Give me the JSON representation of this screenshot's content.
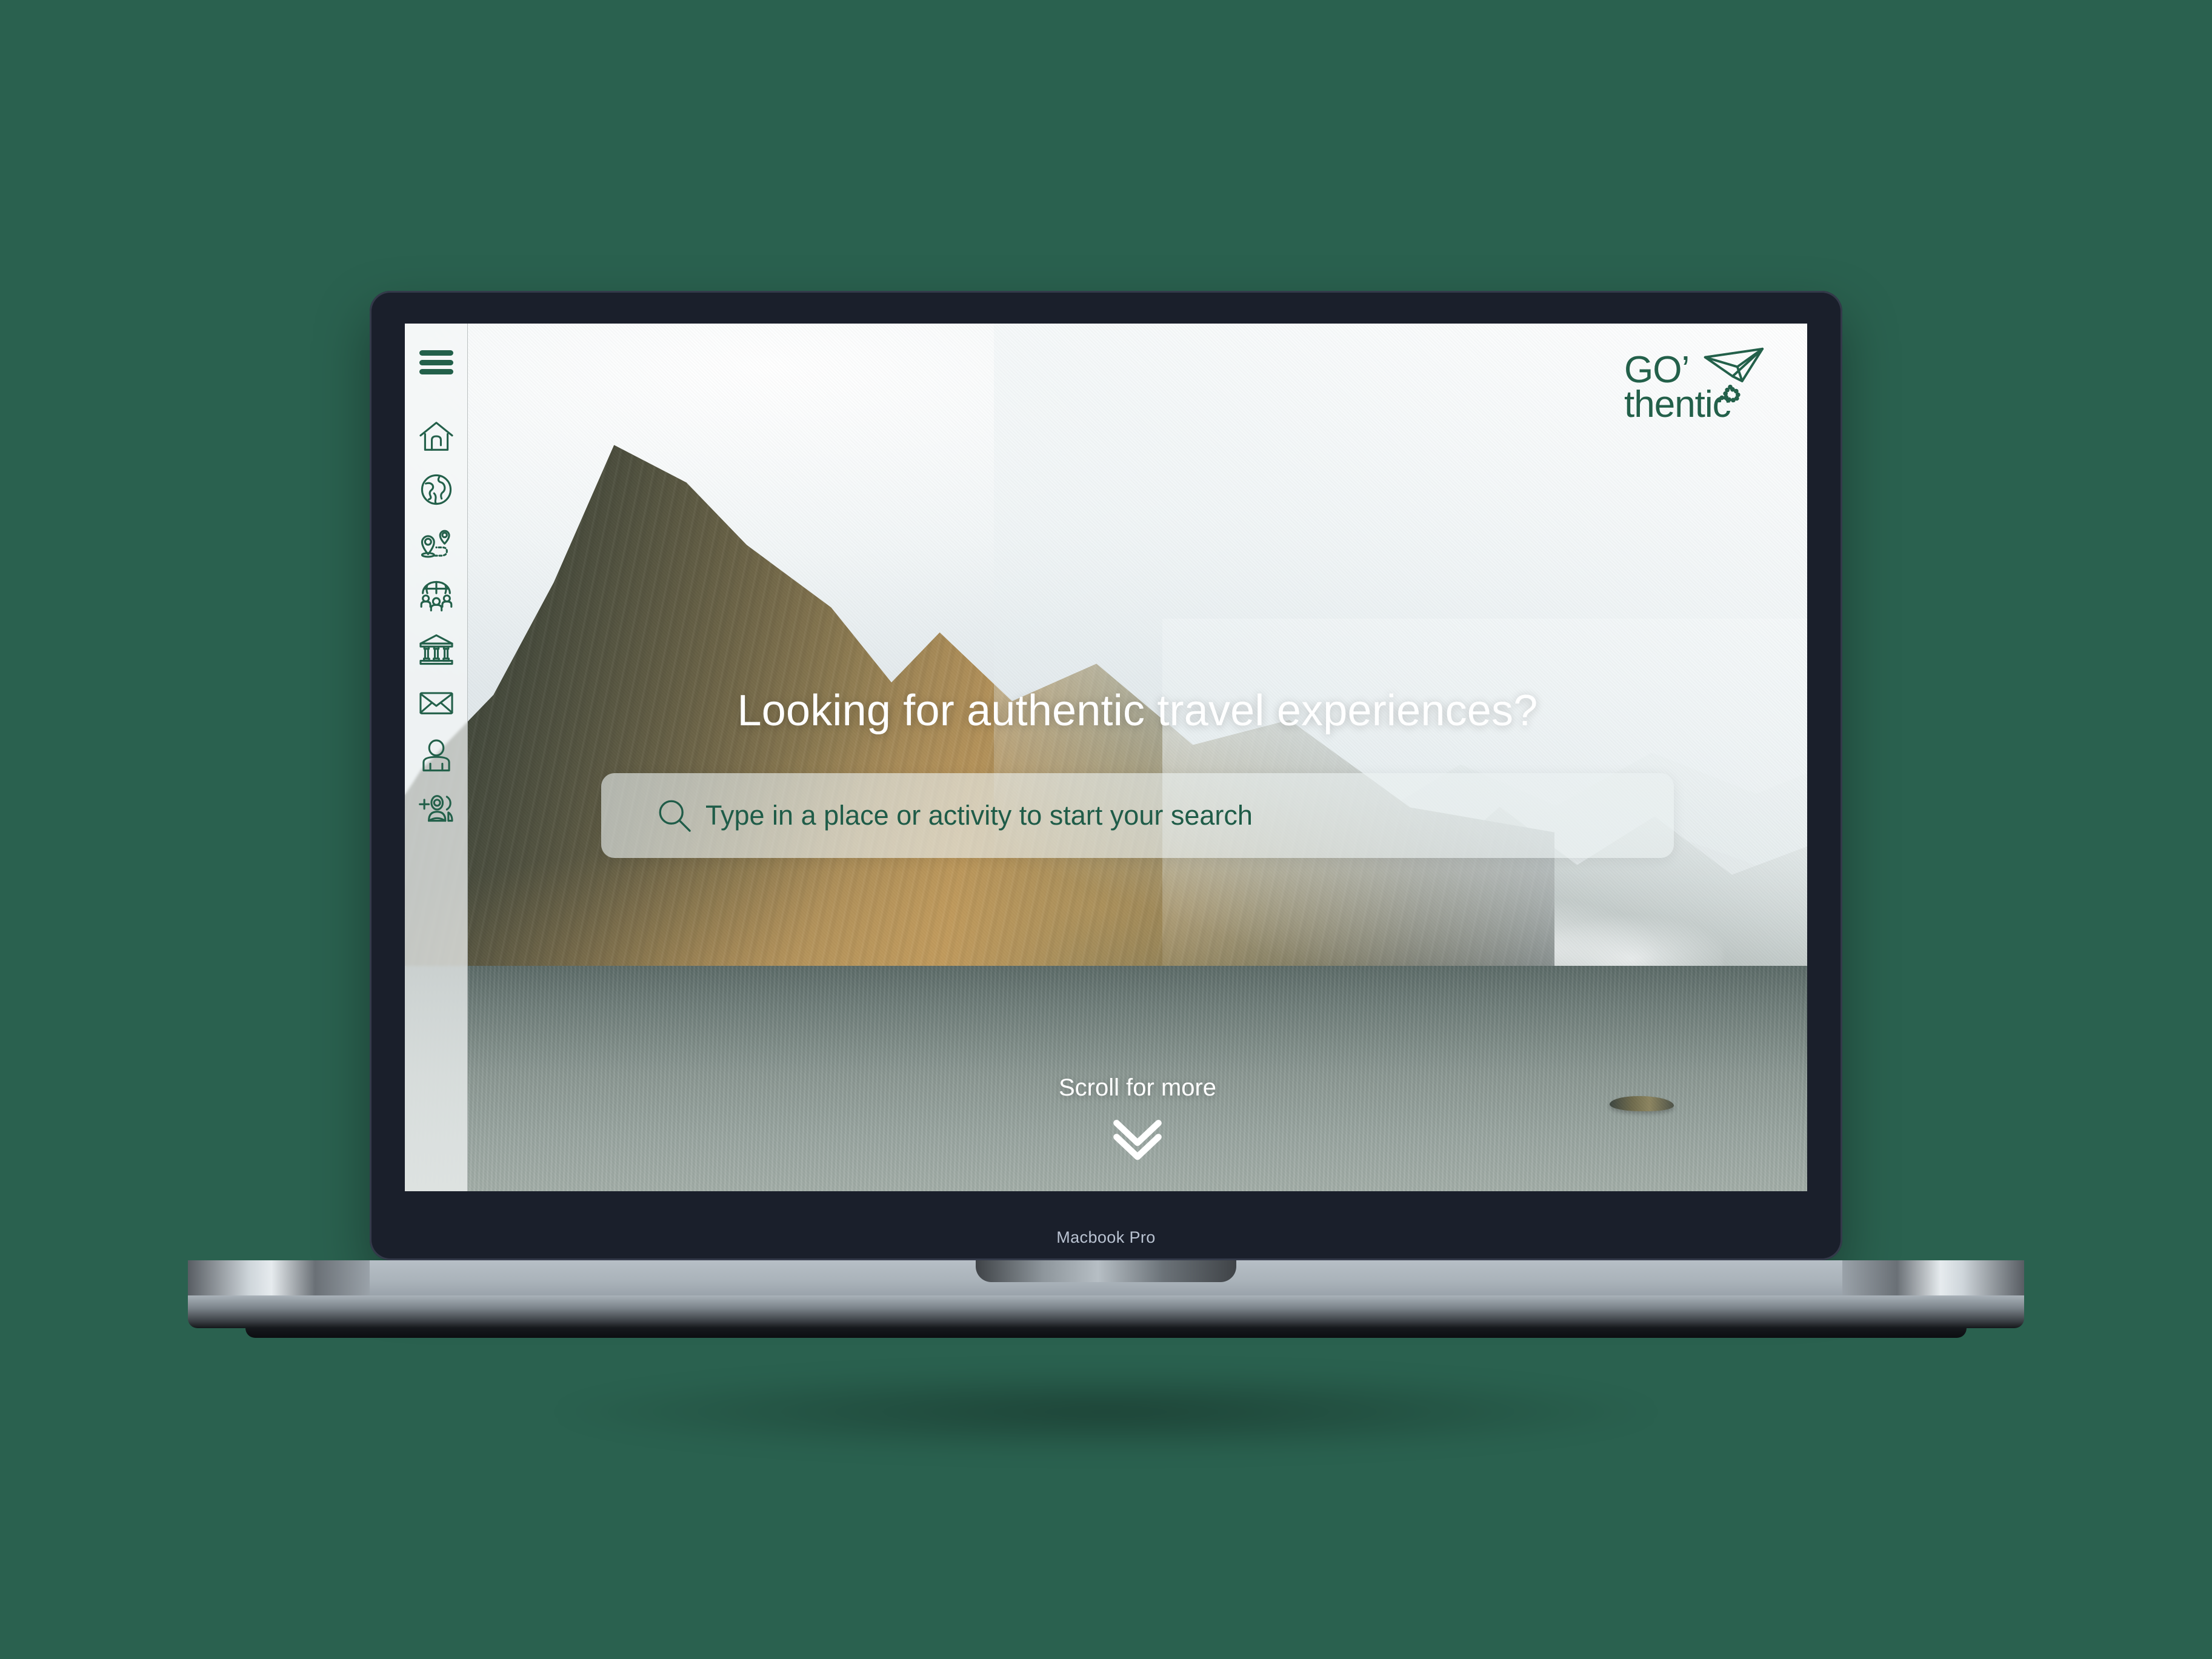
{
  "background_color": "#2A614F",
  "brand_color": "#23604A",
  "device": {
    "name": "Macbook Pro",
    "bezel_color": "#1A1F2B",
    "body_color": "#aab3ba"
  },
  "site": {
    "logo": {
      "line1": "GO’",
      "line2": "thentic",
      "icon": "paper-plane-icon",
      "color": "#23604A"
    },
    "sidebar": {
      "menu_icon": "hamburger-menu-icon",
      "items": [
        {
          "icon": "home-icon",
          "label": "Home"
        },
        {
          "icon": "globe-icon",
          "label": "Explore"
        },
        {
          "icon": "route-pins-icon",
          "label": "Trips"
        },
        {
          "icon": "community-icon",
          "label": "Community"
        },
        {
          "icon": "museum-icon",
          "label": "Culture"
        },
        {
          "icon": "envelope-icon",
          "label": "Messages"
        },
        {
          "icon": "profile-icon",
          "label": "Profile"
        },
        {
          "icon": "add-user-icon",
          "label": "Add user"
        }
      ]
    },
    "hero": {
      "headline": "Looking for authentic travel experiences?",
      "search": {
        "icon": "search-icon",
        "value": "",
        "placeholder": "Type in a place or activity to start your search",
        "text_color": "#1F5C48"
      },
      "scroll_cue": {
        "label": "Scroll for more",
        "icon": "double-chevron-down-icon"
      }
    }
  }
}
